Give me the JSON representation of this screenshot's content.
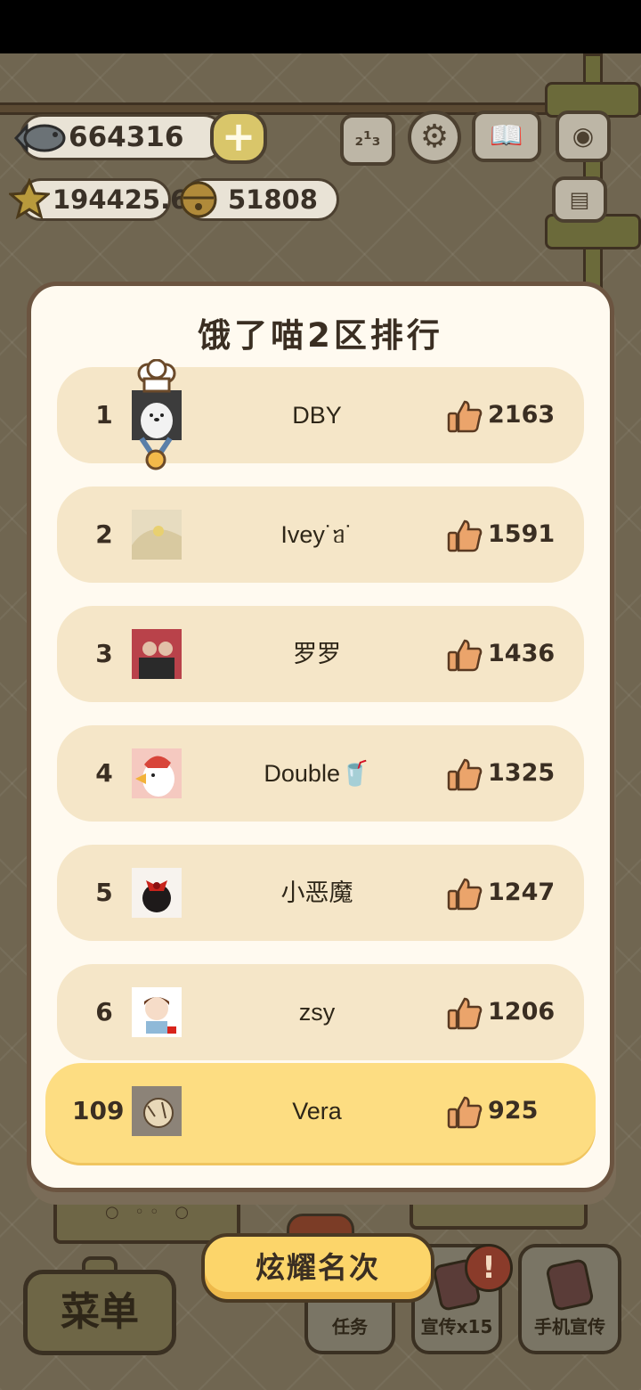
{
  "resources": {
    "fish": "664316",
    "stars": "194425.6",
    "bells": "51808"
  },
  "top_buttons": {
    "plus": "+",
    "rank_icon": "podium-icon",
    "settings_icon": "gear-icon",
    "book_icon": "book-icon",
    "camera_icon": "camera-icon",
    "news_icon": "newspaper-icon"
  },
  "leaderboard": {
    "title": "饿了喵2区排行",
    "rows": [
      {
        "rank": "1",
        "name": "DBY",
        "likes": "2163"
      },
      {
        "rank": "2",
        "name": "Ivey˙ᥑ˙",
        "likes": "1591"
      },
      {
        "rank": "3",
        "name": "罗罗",
        "likes": "1436"
      },
      {
        "rank": "4",
        "name": "Double🥤",
        "likes": "1325"
      },
      {
        "rank": "5",
        "name": "小恶魔",
        "likes": "1247"
      },
      {
        "rank": "6",
        "name": "zsy",
        "likes": "1206"
      }
    ],
    "me": {
      "rank": "109",
      "name": "Vera",
      "likes": "925"
    },
    "share_label": "炫耀名次"
  },
  "bottom_bar": {
    "menu_label": "菜单",
    "task_label": "任务",
    "promo_label": "宣传x15",
    "phone_label": "手机宣传",
    "alert": "!"
  },
  "colors": {
    "modal_bg": "#fffaf0",
    "row_bg": "#f5e6c8",
    "highlight_row": "#fddd82",
    "share_button": "#fcd56a",
    "like_icon": "#eba46b"
  }
}
